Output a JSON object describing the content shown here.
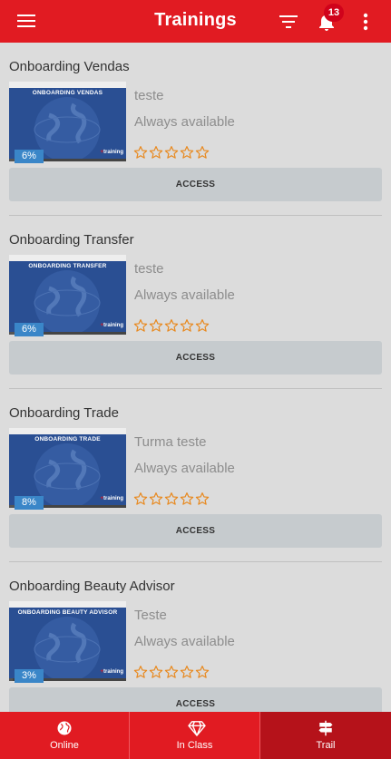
{
  "header": {
    "title": "Trainings",
    "notification_count": "13",
    "color": "#e11b22"
  },
  "trainings": [
    {
      "name": "Onboarding Vendas",
      "thumb_title": "ONBOARDING VENDAS",
      "class": "teste",
      "availability": "Always available",
      "progress": "6%",
      "progress_value": 0.06,
      "rating": 0,
      "access_label": "ACCESS"
    },
    {
      "name": "Onboarding Transfer",
      "thumb_title": "ONBOARDING TRANSFER",
      "class": "teste",
      "availability": "Always available",
      "progress": "6%",
      "progress_value": 0.06,
      "rating": 0,
      "access_label": "ACCESS"
    },
    {
      "name": "Onboarding Trade",
      "thumb_title": "ONBOARDING TRADE",
      "class": "Turma teste",
      "availability": "Always available",
      "progress": "8%",
      "progress_value": 0.08,
      "rating": 0,
      "access_label": "ACCESS"
    },
    {
      "name": "Onboarding Beauty Advisor",
      "thumb_title": "ONBOARDING BEAUTY ADVISOR",
      "class": "Teste",
      "availability": "Always available",
      "progress": "3%",
      "progress_value": 0.03,
      "rating": 0,
      "access_label": "ACCESS"
    }
  ],
  "thumb_brand": {
    "accent": "+",
    "word": "training"
  },
  "bottom_nav": [
    {
      "label": "Online",
      "icon": "globe-icon"
    },
    {
      "label": "In Class",
      "icon": "diamond-icon"
    },
    {
      "label": "Trail",
      "icon": "signpost-icon",
      "active": true
    }
  ]
}
